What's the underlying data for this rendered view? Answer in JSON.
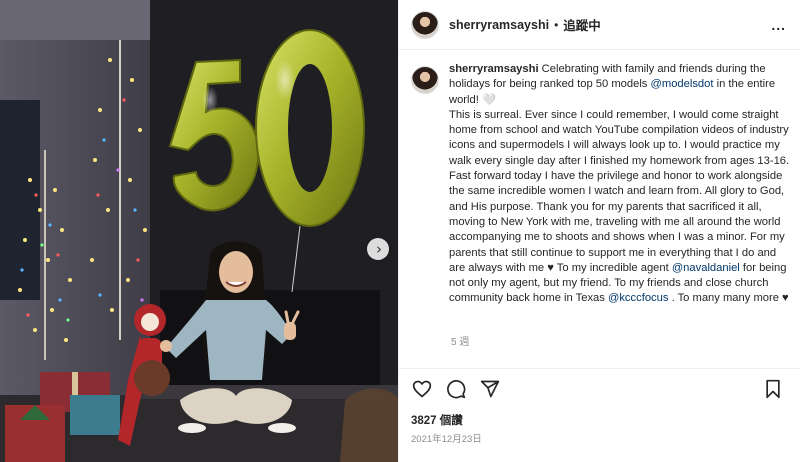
{
  "post": {
    "photo_alt": "Woman sitting in front of a fireplace with gold 50 balloons and lit Christmas trees",
    "balloon_text": "50"
  },
  "header": {
    "username": "sherryramsayshi",
    "separator": "•",
    "follow_label": "追蹤中",
    "more_label": "..."
  },
  "caption": {
    "username": "sherryramsayshi",
    "part1": " Celebrating with family and friends during the holidays for being ranked top 50 models ",
    "mention1": "@modelsdot",
    "part2": " in the entire world! 🤍",
    "part3": "This is surreal. Ever since I could remember, I would come straight home from school and watch YouTube compilation videos of industry icons and supermodels I will always look up to. I would practice my walk every single day after I finished my homework from ages 13-16. Fast forward today I have the privilege and honor to work alongside the same incredible women I watch and learn from. All glory to God, and His purpose. Thank you for my parents that sacrificed it all, moving to New York with me, traveling with me all around the world accompanying me to shoots and shows when I was a minor. For my parents that still continue to support me in everything that I do and are always with me ♥ To my incredible agent ",
    "mention2": "@navaldaniel",
    "part4": " for being not only my agent, but my friend. To my friends and close church community back home in Texas ",
    "mention3": "@kcccfocus",
    "part5": " . To many many more ♥",
    "time_ago": "5 週"
  },
  "actions": {
    "like_icon": "heart-icon",
    "comment_icon": "comment-icon",
    "share_icon": "paper-plane-icon",
    "save_icon": "bookmark-icon"
  },
  "stats": {
    "likes": "3827 個讚",
    "date": "2021年12月23日"
  },
  "carousel": {
    "next_icon": "chevron-right-icon",
    "next_glyph": "›"
  }
}
